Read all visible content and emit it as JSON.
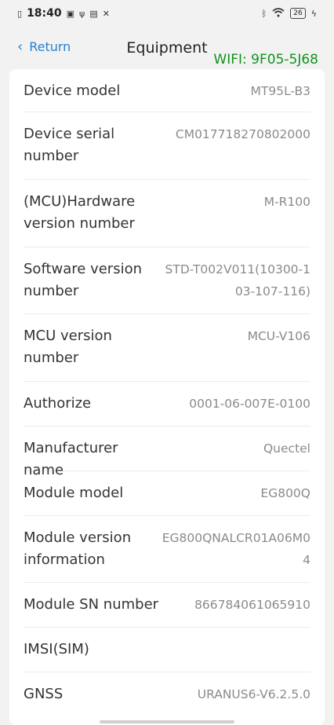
{
  "status_bar": {
    "time": "18:40",
    "battery": "26",
    "icons_left": [
      "notification-icon",
      "app-icon",
      "usb-icon",
      "sim-icon",
      "tools-icon"
    ],
    "icons_right": [
      "bluetooth-icon",
      "wifi-icon",
      "battery-icon",
      "charging-icon"
    ]
  },
  "header": {
    "back_label": "Return",
    "title": "Equipment",
    "wifi": "WIFI: 9F05-5J68"
  },
  "rows": [
    {
      "label": "Device model",
      "value": "MT95L-B3"
    },
    {
      "label": "Device serial number",
      "value": "CM017718270802000"
    },
    {
      "label": "(MCU)Hardware version number",
      "value": "M-R100"
    },
    {
      "label": "Software version number",
      "value": "STD-T002V011(10300-103-107-116)"
    },
    {
      "label": "MCU version number",
      "value": "MCU-V106"
    },
    {
      "label": "Authorize",
      "value": "0001-06-007E-0100"
    },
    {
      "label": "Manufacturer name",
      "value": "Quectel"
    },
    {
      "label": "Module model",
      "value": "EG800Q"
    },
    {
      "label": "Module version information",
      "value": "EG800QNALCR01A06M04"
    },
    {
      "label": "Module SN number",
      "value": "866784061065910"
    },
    {
      "label": "IMSI(SIM)",
      "value": ""
    },
    {
      "label": "GNSS",
      "value": "URANUS6-V6.2.5.0"
    }
  ]
}
